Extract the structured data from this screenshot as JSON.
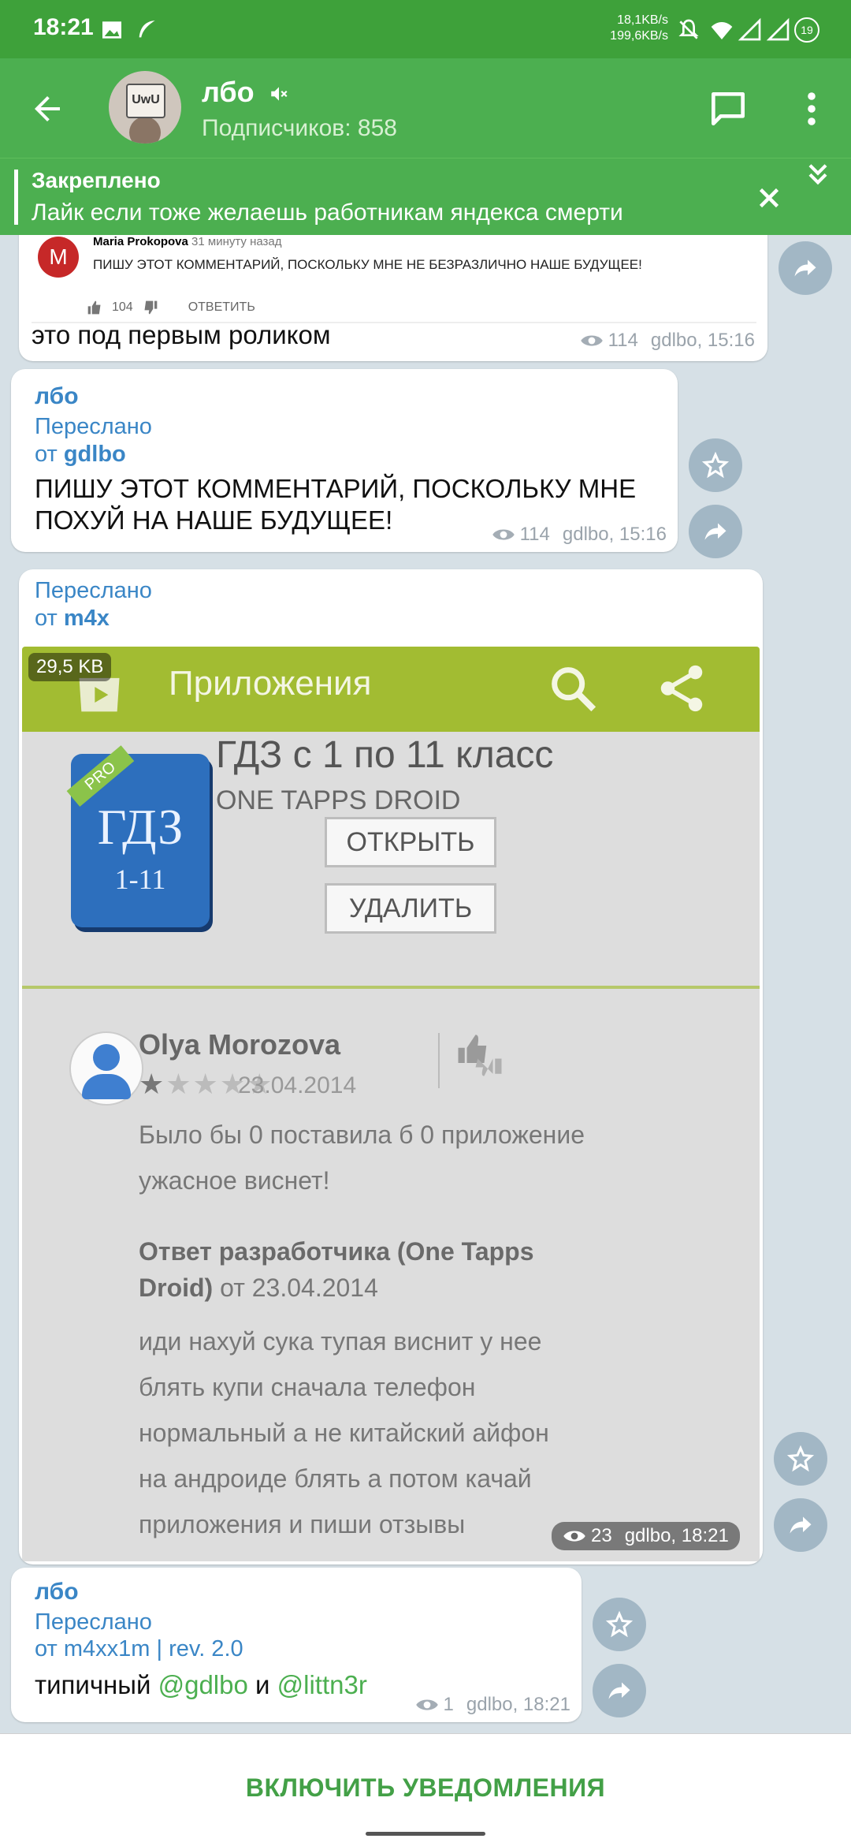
{
  "status_bar": {
    "time": "18:21",
    "net_up": "18,1KB/s",
    "net_down": "199,6KB/s",
    "battery": "19"
  },
  "header": {
    "title": "лбо",
    "subtitle": "Подписчиков: 858",
    "avatar_text": "UwU"
  },
  "pinned": {
    "label": "Закреплено",
    "text": "Лайк если тоже желаешь работникам яндекса смерти"
  },
  "messages": [
    {
      "quote": {
        "avatar_letter": "M",
        "author": "Maria Prokopova",
        "time": "31 минуту назад",
        "text": "ПИШУ ЭТОТ КОММЕНТАРИЙ, ПОСКОЛЬКУ МНЕ НЕ БЕЗРАЗЛИЧНО НАШЕ БУДУЩЕЕ!",
        "likes": "104",
        "reply": "ОТВЕТИТЬ"
      },
      "text": "это под первым роликом",
      "views": "114",
      "author_time": "gdlbo, 15:16"
    },
    {
      "sender": "лбо",
      "forwarded_label": "Переслано",
      "from_prefix": "от",
      "from": "gdlbo",
      "text": "ПИШУ ЭТОТ КОММЕНТАРИЙ, ПОСКОЛЬКУ МНЕ ПОХУЙ НА НАШЕ БУДУЩЕЕ!",
      "views": "114",
      "author_time": "gdlbo, 15:16"
    },
    {
      "forwarded_label": "Переслано",
      "from_prefix": "от",
      "from": "m4x",
      "file_size": "29,5 KB",
      "views": "23",
      "author_time": "gdlbo, 18:21",
      "image": {
        "store_title": "Приложения",
        "app_icon_pro": "PRO",
        "app_icon_main": "ГДЗ",
        "app_icon_sub": "1-11",
        "app_name": "ГДЗ с 1 по 11 класс",
        "developer": "ONE TAPPS DROID",
        "open_button": "ОТКРЫТЬ",
        "uninstall_button": "УДАЛИТЬ",
        "reviewer": "Olya Morozova",
        "rating": 1,
        "review_date": "23.04.2014",
        "review_lines": [
          "Было бы 0 поставила б 0 приложение",
          "ужасное виснет!"
        ],
        "dev_reply_header_1": "Ответ разработчика (One Tapps",
        "dev_reply_header_2_bold": "Droid)",
        "dev_reply_header_2_rest": "от 23.04.2014",
        "dev_reply_lines": [
          "иди нахуй сука тупая виснит у нее",
          "блять купи сначала телефон",
          "нормальный а не китайский айфон",
          "на андроиде блять а потом качай",
          "приложения и пиши отзывы"
        ]
      }
    },
    {
      "sender": "лбо",
      "forwarded_label": "Переслано",
      "from_prefix": "от",
      "from": "m4xx1m | rev. 2.0",
      "text_before": "типичный",
      "mention_1": "@gdlbo",
      "text_middle": "и",
      "mention_2": "@littn3r",
      "views": "1",
      "author_time": "gdlbo, 18:21"
    }
  ],
  "bottom": {
    "notify_button": "ВКЛЮЧИТЬ УВЕДОМЛЕНИЯ"
  },
  "colors": {
    "status_bar": "#3ea13a",
    "header": "#4caf50",
    "link": "#3a86c6",
    "notify": "#43a047",
    "chat_bg": "#d6e0e6"
  }
}
